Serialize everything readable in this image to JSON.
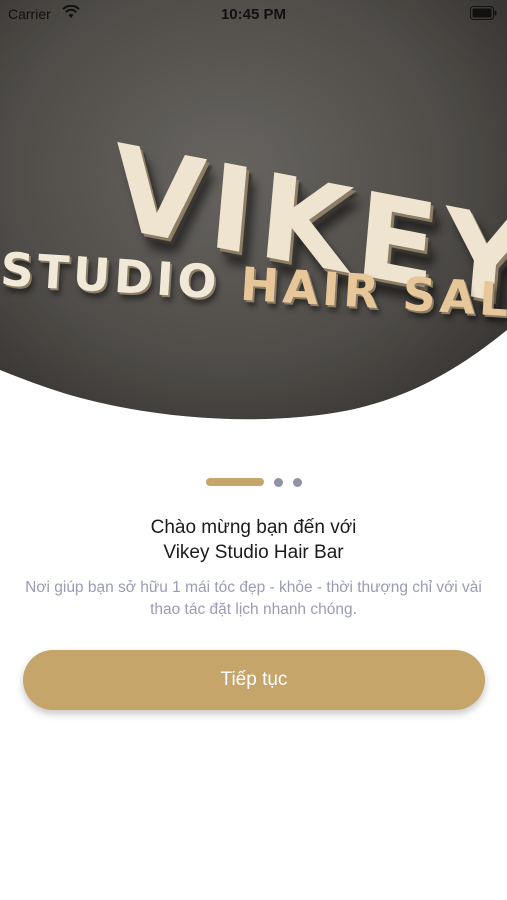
{
  "status_bar": {
    "carrier": "Carrier",
    "time": "10:45 PM",
    "wifi_icon": "wifi-icon",
    "battery_icon": "battery-icon"
  },
  "hero": {
    "sign_line1": "VIKEY",
    "sign_line2_part1": "STUDIO ",
    "sign_line2_part2": "HAIR SAL"
  },
  "onboarding": {
    "pages_total": 3,
    "current_page": 1,
    "title_line1": "Chào mừng bạn đến với",
    "title_line2": "Vikey Studio Hair Bar",
    "description": "Nơi giúp bạn sở hữu 1 mái tóc đẹp - khỏe - thời thượng chỉ với vài thao tác đặt lịch nhanh chóng.",
    "continue_label": "Tiếp tục"
  },
  "colors": {
    "accent": "#c6a56b",
    "inactive_dot": "#8e93a8",
    "description_text": "#9a9cb6"
  }
}
